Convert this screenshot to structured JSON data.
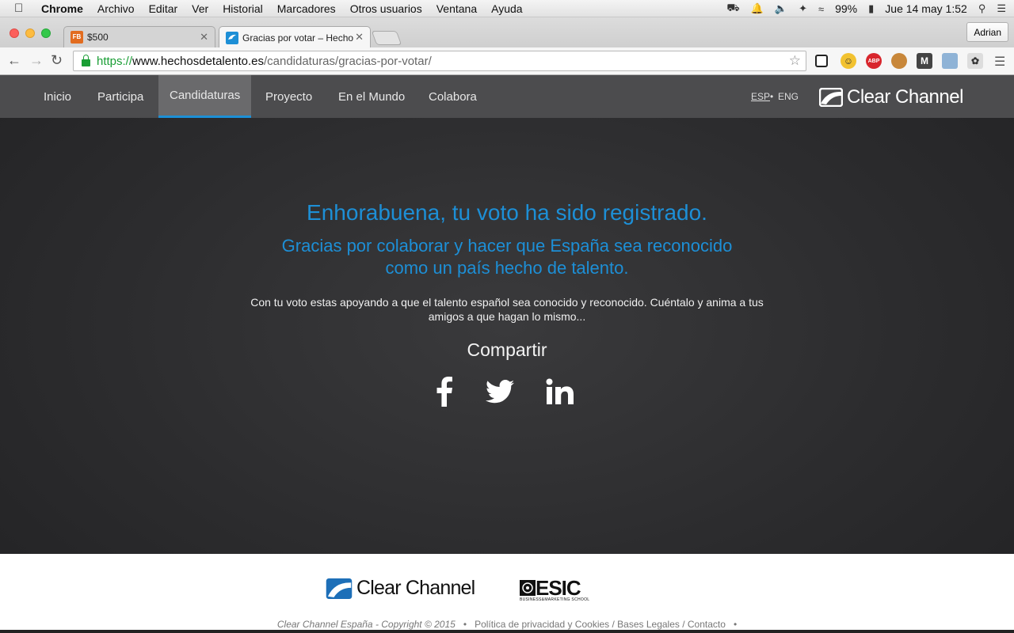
{
  "menubar": {
    "app": "Chrome",
    "items": [
      "Archivo",
      "Editar",
      "Ver",
      "Historial",
      "Marcadores",
      "Otros usuarios",
      "Ventana",
      "Ayuda"
    ],
    "battery": "99%",
    "datetime": "Jue 14 may  1:52"
  },
  "browser": {
    "tabs": [
      {
        "title": "$500",
        "favicon_text": "FB"
      },
      {
        "title": "Gracias por votar – Hechos de talento"
      }
    ],
    "profile": "Adrian",
    "url": {
      "scheme": "https://",
      "host": "www.hechosdetalento.es",
      "path": "/candidaturas/gracias-por-votar/"
    },
    "extensions": [
      "ABP"
    ]
  },
  "site": {
    "nav": [
      "Inicio",
      "Participa",
      "Candidaturas",
      "Proyecto",
      "En el Mundo",
      "Colabora"
    ],
    "active_nav": "Candidaturas",
    "lang": {
      "esp": "ESP",
      "sep": "•",
      "eng": "ENG"
    },
    "brand": "Clear Channel"
  },
  "main": {
    "heading": "Enhorabuena, tu voto ha sido registrado.",
    "subheading": "Gracias por colaborar y hacer que España sea reconocido como un país hecho de talento.",
    "paragraph": "Con tu voto estas apoyando a que el talento español sea conocido y reconocido. Cuéntalo y anima a tus amigos a que hagan lo mismo...",
    "share_label": "Compartir",
    "accent_color": "#1d8fd6"
  },
  "footer": {
    "brand1": "Clear Channel",
    "brand2": "ESIC",
    "brand2_sub": "BUSINESS&MARKETING SCHOOL",
    "copyright": "Clear Channel España - Copyright © 2015",
    "links": "Política de privacidad y Cookies / Bases Legales / Contacto",
    "bullet": "•"
  }
}
